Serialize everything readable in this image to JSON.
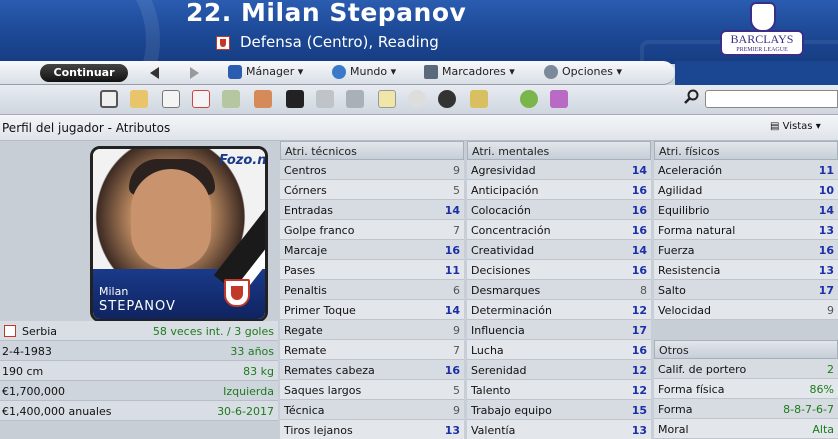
{
  "header": {
    "title": "22. Milan Stepanov",
    "subtitle": "Defensa (Centro), Reading",
    "sponsor": "BARCLAYS",
    "sponsor_sub": "PREMIER LEAGUE"
  },
  "toolbar": {
    "continue": "Continuar",
    "manager": "Mánager",
    "world": "Mundo",
    "scoreboards": "Marcadores",
    "options": "Opciones"
  },
  "subbar": {
    "title": "Perfil del jugador - Atributos",
    "views": "Vistas"
  },
  "player": {
    "first_name": "Milan",
    "last_name": "STEPANOV",
    "watermark": "Fozo.net"
  },
  "info": [
    {
      "label": "Serbia",
      "value": "58 veces int. / 3 goles"
    },
    {
      "label": "2-4-1983",
      "value": "33 años"
    },
    {
      "label": "190 cm",
      "value": "83 kg"
    },
    {
      "label": "€1,700,000",
      "value": "Izquierda"
    },
    {
      "label": "€1,400,000 anuales",
      "value": "30-6-2017"
    }
  ],
  "technical": {
    "title": "Atri. técnicos",
    "rows": [
      {
        "name": "Centros",
        "value": "9",
        "style": "gray"
      },
      {
        "name": "Córners",
        "value": "5",
        "style": "gray"
      },
      {
        "name": "Entradas",
        "value": "14",
        "style": "blue"
      },
      {
        "name": "Golpe franco",
        "value": "7",
        "style": "gray"
      },
      {
        "name": "Marcaje",
        "value": "16",
        "style": "blue"
      },
      {
        "name": "Pases",
        "value": "11",
        "style": "blue"
      },
      {
        "name": "Penaltis",
        "value": "6",
        "style": "gray"
      },
      {
        "name": "Primer Toque",
        "value": "14",
        "style": "blue"
      },
      {
        "name": "Regate",
        "value": "9",
        "style": "gray"
      },
      {
        "name": "Remate",
        "value": "7",
        "style": "gray"
      },
      {
        "name": "Remates cabeza",
        "value": "16",
        "style": "blue"
      },
      {
        "name": "Saques largos",
        "value": "5",
        "style": "gray"
      },
      {
        "name": "Técnica",
        "value": "9",
        "style": "gray"
      },
      {
        "name": "Tiros lejanos",
        "value": "13",
        "style": "blue"
      }
    ]
  },
  "mental": {
    "title": "Atri. mentales",
    "rows": [
      {
        "name": "Agresividad",
        "value": "14",
        "style": "blue"
      },
      {
        "name": "Anticipación",
        "value": "16",
        "style": "blue"
      },
      {
        "name": "Colocación",
        "value": "16",
        "style": "blue"
      },
      {
        "name": "Concentración",
        "value": "16",
        "style": "blue"
      },
      {
        "name": "Creatividad",
        "value": "14",
        "style": "blue"
      },
      {
        "name": "Decisiones",
        "value": "16",
        "style": "blue"
      },
      {
        "name": "Desmarques",
        "value": "8",
        "style": "gray"
      },
      {
        "name": "Determinación",
        "value": "12",
        "style": "blue"
      },
      {
        "name": "Influencia",
        "value": "17",
        "style": "blue"
      },
      {
        "name": "Lucha",
        "value": "16",
        "style": "blue"
      },
      {
        "name": "Serenidad",
        "value": "12",
        "style": "blue"
      },
      {
        "name": "Talento",
        "value": "12",
        "style": "blue"
      },
      {
        "name": "Trabajo equipo",
        "value": "15",
        "style": "blue"
      },
      {
        "name": "Valentía",
        "value": "13",
        "style": "blue"
      }
    ]
  },
  "physical": {
    "title": "Atri. físicos",
    "rows": [
      {
        "name": "Aceleración",
        "value": "11",
        "style": "blue"
      },
      {
        "name": "Agilidad",
        "value": "10",
        "style": "blue"
      },
      {
        "name": "Equilibrio",
        "value": "14",
        "style": "blue"
      },
      {
        "name": "Forma natural",
        "value": "13",
        "style": "blue"
      },
      {
        "name": "Fuerza",
        "value": "16",
        "style": "blue"
      },
      {
        "name": "Resistencia",
        "value": "13",
        "style": "blue"
      },
      {
        "name": "Salto",
        "value": "17",
        "style": "blue"
      },
      {
        "name": "Velocidad",
        "value": "9",
        "style": "gray"
      }
    ]
  },
  "others": {
    "title": "Otros",
    "rows": [
      {
        "name": "Calif. de portero",
        "value": "2",
        "style": "green"
      },
      {
        "name": "Forma física",
        "value": "86%",
        "style": "green"
      },
      {
        "name": "Forma",
        "value": "8-8-7-6-7",
        "style": "green"
      },
      {
        "name": "Moral",
        "value": "Alta",
        "style": "green"
      }
    ]
  }
}
